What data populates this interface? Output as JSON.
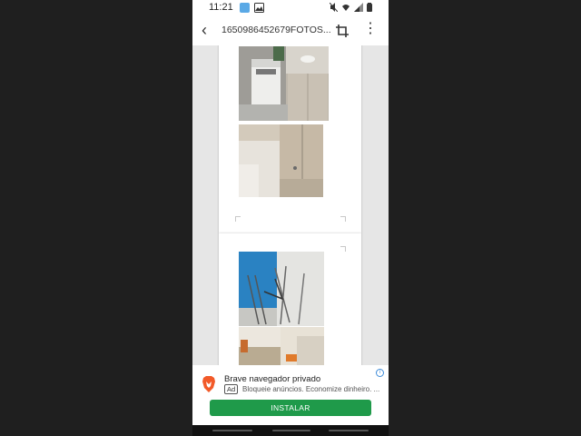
{
  "status_bar": {
    "time": "11:21",
    "left_icons": [
      "notification-app-icon",
      "gallery-icon"
    ],
    "right_icons": [
      "mute-icon",
      "wifi-icon",
      "signal-icon",
      "battery-icon"
    ]
  },
  "app_bar": {
    "back_icon": "arrow-left",
    "title": "1650986452679FOTOS...",
    "crop_icon": "crop",
    "more_icon": "vertical-ellipsis"
  },
  "ad": {
    "title": "Brave navegador privado",
    "badge": "Ad",
    "description": "Bloqueie anúncios. Economize dinheiro. ...",
    "cta": "INSTALAR",
    "cta_color": "#1f9a4a",
    "logo_color": "#f25a29"
  },
  "colors": {
    "background": "#1f1f1f",
    "viewer_background": "#e6e6e6",
    "page": "#ffffff"
  }
}
